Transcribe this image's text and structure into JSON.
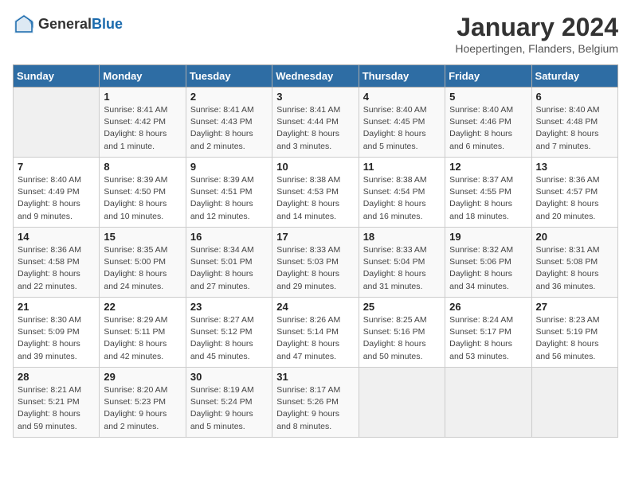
{
  "logo": {
    "general": "General",
    "blue": "Blue"
  },
  "header": {
    "month_year": "January 2024",
    "location": "Hoepertingen, Flanders, Belgium"
  },
  "days_of_week": [
    "Sunday",
    "Monday",
    "Tuesday",
    "Wednesday",
    "Thursday",
    "Friday",
    "Saturday"
  ],
  "weeks": [
    [
      {
        "day": "",
        "sunrise": "",
        "sunset": "",
        "daylight": "",
        "empty": true
      },
      {
        "day": "1",
        "sunrise": "Sunrise: 8:41 AM",
        "sunset": "Sunset: 4:42 PM",
        "daylight": "Daylight: 8 hours and 1 minute."
      },
      {
        "day": "2",
        "sunrise": "Sunrise: 8:41 AM",
        "sunset": "Sunset: 4:43 PM",
        "daylight": "Daylight: 8 hours and 2 minutes."
      },
      {
        "day": "3",
        "sunrise": "Sunrise: 8:41 AM",
        "sunset": "Sunset: 4:44 PM",
        "daylight": "Daylight: 8 hours and 3 minutes."
      },
      {
        "day": "4",
        "sunrise": "Sunrise: 8:40 AM",
        "sunset": "Sunset: 4:45 PM",
        "daylight": "Daylight: 8 hours and 5 minutes."
      },
      {
        "day": "5",
        "sunrise": "Sunrise: 8:40 AM",
        "sunset": "Sunset: 4:46 PM",
        "daylight": "Daylight: 8 hours and 6 minutes."
      },
      {
        "day": "6",
        "sunrise": "Sunrise: 8:40 AM",
        "sunset": "Sunset: 4:48 PM",
        "daylight": "Daylight: 8 hours and 7 minutes."
      }
    ],
    [
      {
        "day": "7",
        "sunrise": "Sunrise: 8:40 AM",
        "sunset": "Sunset: 4:49 PM",
        "daylight": "Daylight: 8 hours and 9 minutes."
      },
      {
        "day": "8",
        "sunrise": "Sunrise: 8:39 AM",
        "sunset": "Sunset: 4:50 PM",
        "daylight": "Daylight: 8 hours and 10 minutes."
      },
      {
        "day": "9",
        "sunrise": "Sunrise: 8:39 AM",
        "sunset": "Sunset: 4:51 PM",
        "daylight": "Daylight: 8 hours and 12 minutes."
      },
      {
        "day": "10",
        "sunrise": "Sunrise: 8:38 AM",
        "sunset": "Sunset: 4:53 PM",
        "daylight": "Daylight: 8 hours and 14 minutes."
      },
      {
        "day": "11",
        "sunrise": "Sunrise: 8:38 AM",
        "sunset": "Sunset: 4:54 PM",
        "daylight": "Daylight: 8 hours and 16 minutes."
      },
      {
        "day": "12",
        "sunrise": "Sunrise: 8:37 AM",
        "sunset": "Sunset: 4:55 PM",
        "daylight": "Daylight: 8 hours and 18 minutes."
      },
      {
        "day": "13",
        "sunrise": "Sunrise: 8:36 AM",
        "sunset": "Sunset: 4:57 PM",
        "daylight": "Daylight: 8 hours and 20 minutes."
      }
    ],
    [
      {
        "day": "14",
        "sunrise": "Sunrise: 8:36 AM",
        "sunset": "Sunset: 4:58 PM",
        "daylight": "Daylight: 8 hours and 22 minutes."
      },
      {
        "day": "15",
        "sunrise": "Sunrise: 8:35 AM",
        "sunset": "Sunset: 5:00 PM",
        "daylight": "Daylight: 8 hours and 24 minutes."
      },
      {
        "day": "16",
        "sunrise": "Sunrise: 8:34 AM",
        "sunset": "Sunset: 5:01 PM",
        "daylight": "Daylight: 8 hours and 27 minutes."
      },
      {
        "day": "17",
        "sunrise": "Sunrise: 8:33 AM",
        "sunset": "Sunset: 5:03 PM",
        "daylight": "Daylight: 8 hours and 29 minutes."
      },
      {
        "day": "18",
        "sunrise": "Sunrise: 8:33 AM",
        "sunset": "Sunset: 5:04 PM",
        "daylight": "Daylight: 8 hours and 31 minutes."
      },
      {
        "day": "19",
        "sunrise": "Sunrise: 8:32 AM",
        "sunset": "Sunset: 5:06 PM",
        "daylight": "Daylight: 8 hours and 34 minutes."
      },
      {
        "day": "20",
        "sunrise": "Sunrise: 8:31 AM",
        "sunset": "Sunset: 5:08 PM",
        "daylight": "Daylight: 8 hours and 36 minutes."
      }
    ],
    [
      {
        "day": "21",
        "sunrise": "Sunrise: 8:30 AM",
        "sunset": "Sunset: 5:09 PM",
        "daylight": "Daylight: 8 hours and 39 minutes."
      },
      {
        "day": "22",
        "sunrise": "Sunrise: 8:29 AM",
        "sunset": "Sunset: 5:11 PM",
        "daylight": "Daylight: 8 hours and 42 minutes."
      },
      {
        "day": "23",
        "sunrise": "Sunrise: 8:27 AM",
        "sunset": "Sunset: 5:12 PM",
        "daylight": "Daylight: 8 hours and 45 minutes."
      },
      {
        "day": "24",
        "sunrise": "Sunrise: 8:26 AM",
        "sunset": "Sunset: 5:14 PM",
        "daylight": "Daylight: 8 hours and 47 minutes."
      },
      {
        "day": "25",
        "sunrise": "Sunrise: 8:25 AM",
        "sunset": "Sunset: 5:16 PM",
        "daylight": "Daylight: 8 hours and 50 minutes."
      },
      {
        "day": "26",
        "sunrise": "Sunrise: 8:24 AM",
        "sunset": "Sunset: 5:17 PM",
        "daylight": "Daylight: 8 hours and 53 minutes."
      },
      {
        "day": "27",
        "sunrise": "Sunrise: 8:23 AM",
        "sunset": "Sunset: 5:19 PM",
        "daylight": "Daylight: 8 hours and 56 minutes."
      }
    ],
    [
      {
        "day": "28",
        "sunrise": "Sunrise: 8:21 AM",
        "sunset": "Sunset: 5:21 PM",
        "daylight": "Daylight: 8 hours and 59 minutes."
      },
      {
        "day": "29",
        "sunrise": "Sunrise: 8:20 AM",
        "sunset": "Sunset: 5:23 PM",
        "daylight": "Daylight: 9 hours and 2 minutes."
      },
      {
        "day": "30",
        "sunrise": "Sunrise: 8:19 AM",
        "sunset": "Sunset: 5:24 PM",
        "daylight": "Daylight: 9 hours and 5 minutes."
      },
      {
        "day": "31",
        "sunrise": "Sunrise: 8:17 AM",
        "sunset": "Sunset: 5:26 PM",
        "daylight": "Daylight: 9 hours and 8 minutes."
      },
      {
        "day": "",
        "sunrise": "",
        "sunset": "",
        "daylight": "",
        "empty": true
      },
      {
        "day": "",
        "sunrise": "",
        "sunset": "",
        "daylight": "",
        "empty": true
      },
      {
        "day": "",
        "sunrise": "",
        "sunset": "",
        "daylight": "",
        "empty": true
      }
    ]
  ]
}
